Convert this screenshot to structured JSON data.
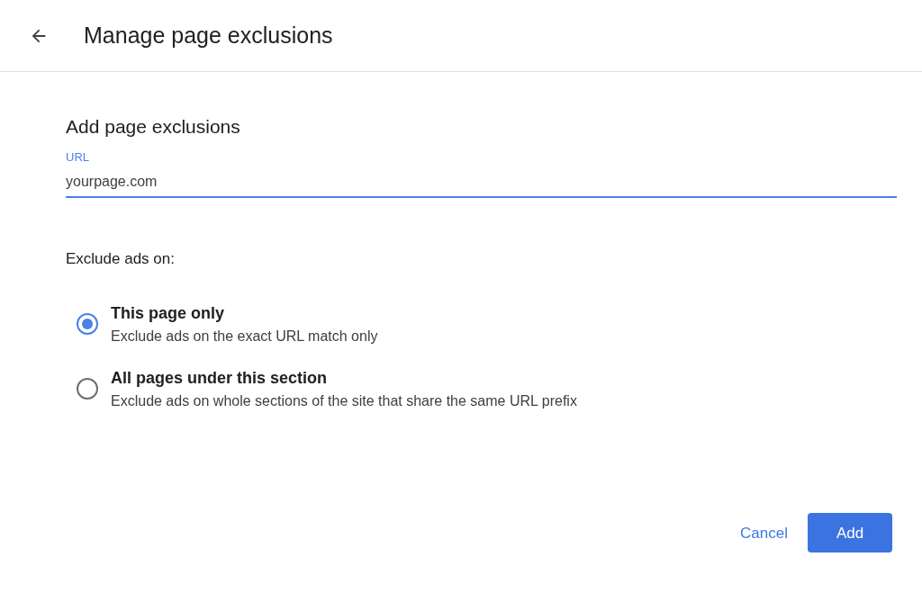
{
  "header": {
    "title": "Manage page exclusions"
  },
  "section_title": "Add page exclusions",
  "url_field": {
    "label": "URL",
    "value": "yourpage.com",
    "focused": true
  },
  "exclude_label": "Exclude ads on:",
  "options": [
    {
      "title": "This page only",
      "description": "Exclude ads on the exact URL match only",
      "selected": true
    },
    {
      "title": "All pages under this section",
      "description": "Exclude ads on whole sections of the site that share the same URL prefix",
      "selected": false
    }
  ],
  "buttons": {
    "cancel": "Cancel",
    "add": "Add"
  }
}
